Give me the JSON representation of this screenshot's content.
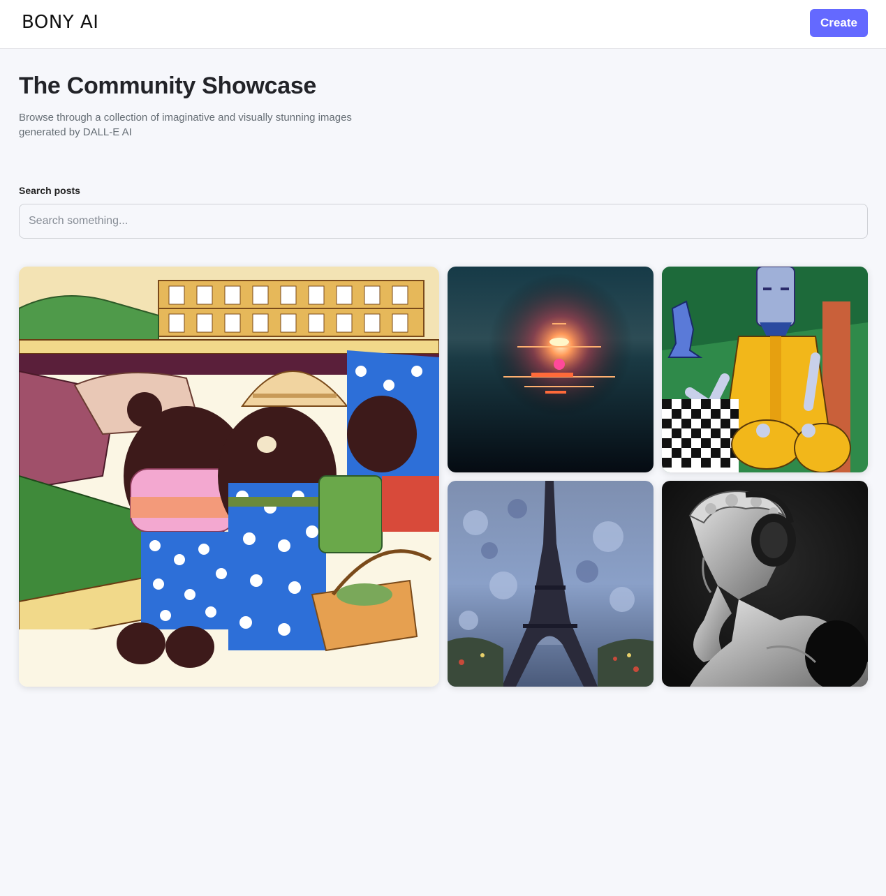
{
  "header": {
    "logo": "BONY AI",
    "create_label": "Create",
    "accent_color": "#6469ff"
  },
  "main": {
    "title": "The Community Showcase",
    "subtitle": "Browse through a collection of imaginative and visually stunning images generated by DALL-E AI"
  },
  "search": {
    "label": "Search posts",
    "placeholder": "Search something...",
    "value": ""
  },
  "gallery": {
    "items": [
      {
        "icon": "bears-shopping-image"
      },
      {
        "icon": "sunset-sea-image"
      },
      {
        "icon": "robot-chess-image"
      },
      {
        "icon": "eiffel-tower-painting-image"
      },
      {
        "icon": "statue-headphones-image"
      }
    ]
  }
}
